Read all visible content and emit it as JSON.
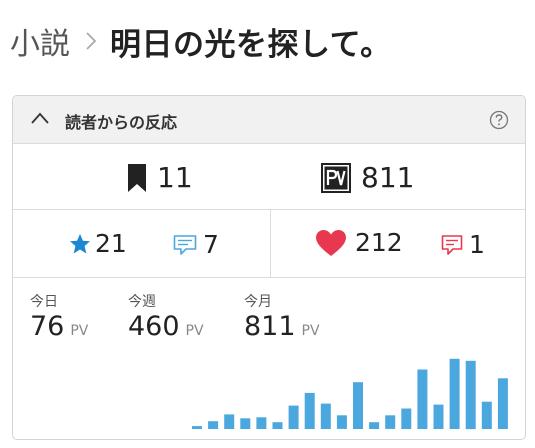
{
  "breadcrumb": {
    "root": "小説",
    "title": "明日の光を探して。"
  },
  "panel": {
    "title": "読者からの反応"
  },
  "stats": {
    "bookmarks": "11",
    "pv_total": "811",
    "stars": "21",
    "reviews": "7",
    "likes": "212",
    "comments": "1"
  },
  "pageviews": {
    "today": {
      "label": "今日",
      "value": "76",
      "unit": "PV"
    },
    "week": {
      "label": "今週",
      "value": "460",
      "unit": "PV"
    },
    "month": {
      "label": "今月",
      "value": "811",
      "unit": "PV"
    }
  },
  "colors": {
    "bar": "#4aa8de",
    "star": "#1e87d4",
    "heart": "#e8384f",
    "review": "#4aa8de",
    "comment": "#e8384f"
  },
  "icons": [
    "chevron-up-icon",
    "help-icon",
    "bookmark-icon",
    "pv-icon",
    "star-icon",
    "review-icon",
    "heart-icon",
    "comment-icon"
  ],
  "chart_data": {
    "type": "bar",
    "values": [
      3,
      8,
      15,
      11,
      12,
      7,
      24,
      37,
      26,
      14,
      48,
      7,
      14,
      21,
      61,
      25,
      72,
      70,
      28,
      52
    ],
    "ylim": [
      0,
      80
    ],
    "grid": false,
    "legend": "none"
  }
}
